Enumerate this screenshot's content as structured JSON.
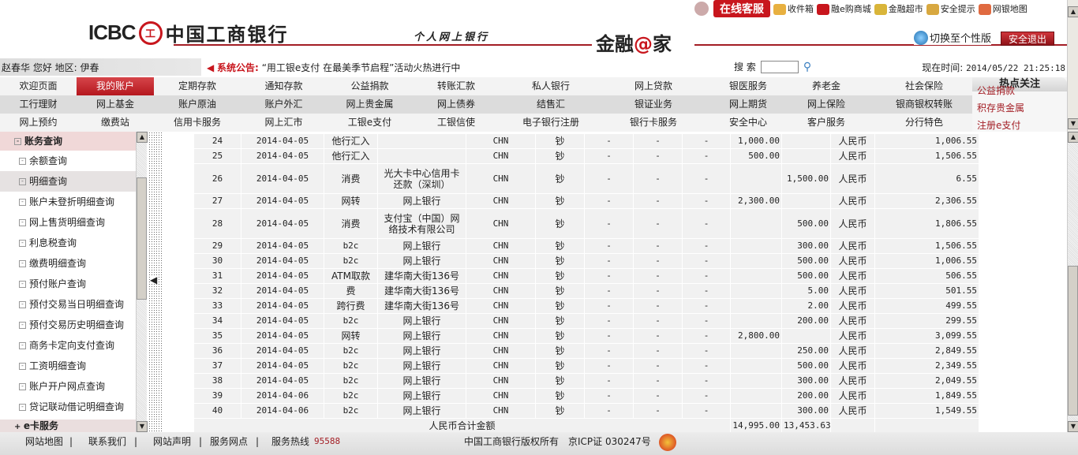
{
  "topbar": {
    "online_service": "在线客服",
    "links": [
      {
        "label": "收件箱",
        "icon": "inbox-icon"
      },
      {
        "label": "融e购商城",
        "icon": "cart-icon"
      },
      {
        "label": "金融超市",
        "icon": "basket-icon"
      },
      {
        "label": "安全提示",
        "icon": "lock-icon"
      },
      {
        "label": "网银地图",
        "icon": "map-icon"
      }
    ]
  },
  "header": {
    "logo_en": "ICBC",
    "logo_seal": "工",
    "logo_cn": "中国工商银行",
    "subtitle": "个人网上银行",
    "brand_prefix": "金融",
    "brand_at": "@",
    "brand_suffix": "家",
    "switch_label": "切换至个性版",
    "logout_label": "安全退出"
  },
  "info": {
    "user": "赵春华 您好 地区:  伊春",
    "announce_label": "系统公告:",
    "announce_text": "“用工银e支付 在最美季节启程”活动火热进行中",
    "search_label": "搜 索",
    "search_value": "",
    "time_label": "现在时间:",
    "time_value": "2014/05/22 21:25:18"
  },
  "nav": {
    "row1": [
      "欢迎页面",
      "我的账户",
      "定期存款",
      "通知存款",
      "公益捐款",
      "转账汇款",
      "私人银行",
      "网上贷款",
      "银医服务",
      "养老金",
      "社会保险"
    ],
    "row2": [
      "工行理财",
      "网上基金",
      "账户原油",
      "账户外汇",
      "网上贵金属",
      "网上债券",
      "结售汇",
      "银证业务",
      "网上期货",
      "网上保险",
      "银商银权转账"
    ],
    "row3": [
      "网上预约",
      "缴费站",
      "信用卡服务",
      "网上汇市",
      "工银e支付",
      "工银信使",
      "电子银行注册",
      "银行卡服务",
      "安全中心",
      "客户服务",
      "分行特色"
    ],
    "active": "我的账户"
  },
  "hot": {
    "title": "热点关注",
    "links": [
      "公益捐款",
      "积存贵金属",
      "注册e支付"
    ]
  },
  "sidebar": {
    "group": "账务查询",
    "items": [
      "余额查询",
      "明细查询",
      "账户未登折明细查询",
      "网上售货明细查询",
      "利息税查询",
      "缴费明细查询",
      "预付账户查询",
      "预付交易当日明细查询",
      "预付交易历史明细查询",
      "商务卡定向支付查询",
      "工资明细查询",
      "账户开户网点查询",
      "贷记联动借记明细查询"
    ],
    "selected": "明细查询",
    "next_group": "e卡服务"
  },
  "table": {
    "rows": [
      [
        "24",
        "2014-04-05",
        "他行汇入",
        "",
        "CHN",
        "钞",
        "-",
        "-",
        "-",
        "1,000.00",
        "",
        "人民币",
        "1,006.55"
      ],
      [
        "25",
        "2014-04-05",
        "他行汇入",
        "",
        "CHN",
        "钞",
        "-",
        "-",
        "-",
        "500.00",
        "",
        "人民币",
        "1,506.55"
      ],
      [
        "26",
        "2014-04-05",
        "消费",
        "光大卡中心信用卡还款（深圳）",
        "CHN",
        "钞",
        "-",
        "-",
        "-",
        "",
        "1,500.00",
        "人民币",
        "6.55"
      ],
      [
        "27",
        "2014-04-05",
        "网转",
        "网上银行",
        "CHN",
        "钞",
        "-",
        "-",
        "-",
        "2,300.00",
        "",
        "人民币",
        "2,306.55"
      ],
      [
        "28",
        "2014-04-05",
        "消费",
        "支付宝（中国）网络技术有限公司",
        "CHN",
        "钞",
        "-",
        "-",
        "-",
        "",
        "500.00",
        "人民币",
        "1,806.55"
      ],
      [
        "29",
        "2014-04-05",
        "b2c",
        "网上银行",
        "CHN",
        "钞",
        "-",
        "-",
        "-",
        "",
        "300.00",
        "人民币",
        "1,506.55"
      ],
      [
        "30",
        "2014-04-05",
        "b2c",
        "网上银行",
        "CHN",
        "钞",
        "-",
        "-",
        "-",
        "",
        "500.00",
        "人民币",
        "1,006.55"
      ],
      [
        "31",
        "2014-04-05",
        "ATM取款",
        "建华南大街136号",
        "CHN",
        "钞",
        "-",
        "-",
        "-",
        "",
        "500.00",
        "人民币",
        "506.55"
      ],
      [
        "32",
        "2014-04-05",
        "费",
        "建华南大街136号",
        "CHN",
        "钞",
        "-",
        "-",
        "-",
        "",
        "5.00",
        "人民币",
        "501.55"
      ],
      [
        "33",
        "2014-04-05",
        "跨行费",
        "建华南大街136号",
        "CHN",
        "钞",
        "-",
        "-",
        "-",
        "",
        "2.00",
        "人民币",
        "499.55"
      ],
      [
        "34",
        "2014-04-05",
        "b2c",
        "网上银行",
        "CHN",
        "钞",
        "-",
        "-",
        "-",
        "",
        "200.00",
        "人民币",
        "299.55"
      ],
      [
        "35",
        "2014-04-05",
        "网转",
        "网上银行",
        "CHN",
        "钞",
        "-",
        "-",
        "-",
        "2,800.00",
        "",
        "人民币",
        "3,099.55"
      ],
      [
        "36",
        "2014-04-05",
        "b2c",
        "网上银行",
        "CHN",
        "钞",
        "-",
        "-",
        "-",
        "",
        "250.00",
        "人民币",
        "2,849.55"
      ],
      [
        "37",
        "2014-04-05",
        "b2c",
        "网上银行",
        "CHN",
        "钞",
        "-",
        "-",
        "-",
        "",
        "500.00",
        "人民币",
        "2,349.55"
      ],
      [
        "38",
        "2014-04-05",
        "b2c",
        "网上银行",
        "CHN",
        "钞",
        "-",
        "-",
        "-",
        "",
        "300.00",
        "人民币",
        "2,049.55"
      ],
      [
        "39",
        "2014-04-06",
        "b2c",
        "网上银行",
        "CHN",
        "钞",
        "-",
        "-",
        "-",
        "",
        "200.00",
        "人民币",
        "1,849.55"
      ],
      [
        "40",
        "2014-04-06",
        "b2c",
        "网上银行",
        "CHN",
        "钞",
        "-",
        "-",
        "-",
        "",
        "300.00",
        "人民币",
        "1,549.55"
      ]
    ],
    "total_label": "人民币合计金额",
    "total_income": "14,995.00",
    "total_expense": "13,453.63"
  },
  "footer": {
    "links": [
      "网站地图",
      "联系我们",
      "网站声明",
      "服务网点"
    ],
    "hotline_label": "服务热线",
    "hotline": "95588",
    "copyright": "中国工商银行版权所有",
    "icp": "京ICP证 030247号"
  },
  "colors": {
    "brand_red": "#c8161d",
    "dark_red": "#a31d24"
  }
}
